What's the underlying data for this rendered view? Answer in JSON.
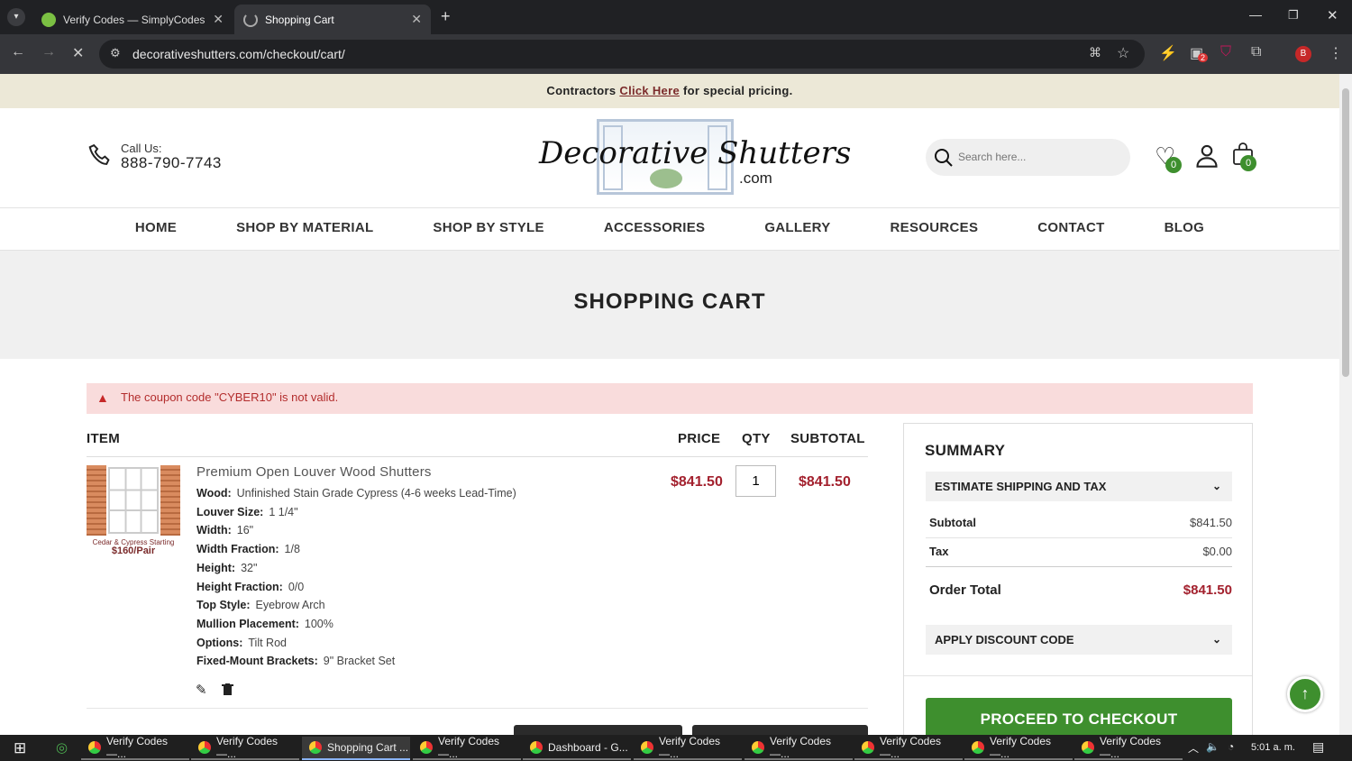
{
  "browser": {
    "tabs": [
      {
        "title": "Verify Codes — SimplyCodes",
        "active": false
      },
      {
        "title": "Shopping Cart",
        "active": true
      }
    ],
    "url": "decorativeshutters.com/checkout/cart/",
    "ext_badge": "2",
    "profile_initial": "B"
  },
  "promo": {
    "prefix": "Contractors",
    "link": "Click Here",
    "suffix": "for special pricing."
  },
  "header": {
    "call_label": "Call Us:",
    "phone": "888-790-7743",
    "logo_line1": "Decorative Shutters",
    "logo_line2": ".com",
    "search_placeholder": "Search here...",
    "wishlist_count": "0",
    "cart_count": "0"
  },
  "nav": [
    "HOME",
    "SHOP BY MATERIAL",
    "SHOP BY STYLE",
    "ACCESSORIES",
    "GALLERY",
    "RESOURCES",
    "CONTACT",
    "BLOG"
  ],
  "hero_title": "SHOPPING CART",
  "alert": "The coupon code \"CYBER10\" is not valid.",
  "cart": {
    "headers": {
      "item": "ITEM",
      "price": "PRICE",
      "qty": "QTY",
      "subtotal": "SUBTOTAL"
    },
    "product": {
      "name": "Premium Open Louver Wood Shutters",
      "thumb_caption1": "Cedar & Cypress Starting",
      "thumb_caption2": "$160/Pair",
      "price": "$841.50",
      "qty": "1",
      "subtotal": "$841.50",
      "options": [
        {
          "label": "Wood:",
          "value": "Unfinished Stain Grade Cypress (4-6 weeks Lead-Time)"
        },
        {
          "label": "Louver Size:",
          "value": "1 1/4\""
        },
        {
          "label": "Width:",
          "value": "16\""
        },
        {
          "label": "Width Fraction:",
          "value": "1/8"
        },
        {
          "label": "Height:",
          "value": "32\""
        },
        {
          "label": "Height Fraction:",
          "value": "0/0"
        },
        {
          "label": "Top Style:",
          "value": "Eyebrow Arch"
        },
        {
          "label": "Mullion Placement:",
          "value": "100%"
        },
        {
          "label": "Options:",
          "value": "Tilt Rod"
        },
        {
          "label": "Fixed-Mount Brackets:",
          "value": "9\" Bracket Set"
        }
      ]
    }
  },
  "summary": {
    "title": "SUMMARY",
    "estimate": "ESTIMATE SHIPPING AND TAX",
    "subtotal_label": "Subtotal",
    "subtotal": "$841.50",
    "tax_label": "Tax",
    "tax": "$0.00",
    "total_label": "Order Total",
    "total": "$841.50",
    "discount": "APPLY DISCOUNT CODE",
    "checkout": "PROCEED TO CHECKOUT"
  },
  "taskbar": {
    "items": [
      "Verify Codes —...",
      "Verify Codes —...",
      "Shopping Cart ...",
      "Verify Codes —...",
      "Dashboard - G...",
      "Verify Codes —...",
      "Verify Codes —...",
      "Verify Codes —...",
      "Verify Codes —...",
      "Verify Codes —..."
    ],
    "time": "5:01 a. m."
  },
  "colors": {
    "accent_red": "#a3212e",
    "checkout_green": "#3e8f2e",
    "promo_bg": "#ece8d7"
  }
}
